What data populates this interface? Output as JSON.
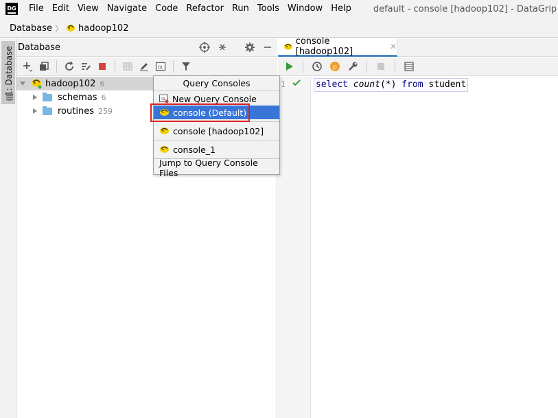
{
  "app": {
    "logo_text": "DG",
    "menu": [
      "File",
      "Edit",
      "View",
      "Navigate",
      "Code",
      "Refactor",
      "Run",
      "Tools",
      "Window",
      "Help"
    ],
    "window_title": "default - console [hadoop102] - DataGrip"
  },
  "breadcrumb": [
    "Database",
    "hadoop102"
  ],
  "tool_strip": {
    "tab_label": "1: Database"
  },
  "database_panel": {
    "title": "Database",
    "tree": [
      {
        "label": "hadoop102",
        "count": "6",
        "expanded": true,
        "level": 0
      },
      {
        "label": "schemas",
        "count": "6",
        "expanded": false,
        "level": 1
      },
      {
        "label": "routines",
        "count": "259",
        "expanded": false,
        "level": 1
      }
    ]
  },
  "popup": {
    "title": "Query Consoles",
    "items": [
      {
        "label": "New Query Console",
        "icon": "new-console-icon",
        "active": false
      },
      {
        "label": "console (Default)",
        "icon": "hadoop-console-icon",
        "active": true
      },
      {
        "label": "console [hadoop102]",
        "icon": "hadoop-console-icon",
        "active": false
      },
      {
        "label": "console_1",
        "icon": "hadoop-console-icon",
        "active": false
      },
      {
        "label": "Jump to Query Console Files",
        "icon": "",
        "active": false
      }
    ]
  },
  "editor": {
    "tab_label": "console [hadoop102]",
    "line_number": "1",
    "code_tokens": [
      {
        "text": "select",
        "kind": "kw"
      },
      {
        "text": " ",
        "kind": "plain"
      },
      {
        "text": "count",
        "kind": "fn"
      },
      {
        "text": "(*) ",
        "kind": "plain"
      },
      {
        "text": "from",
        "kind": "kw"
      },
      {
        "text": " student",
        "kind": "ident"
      }
    ]
  },
  "colors": {
    "selection": "#3875d7",
    "highlight_box": "#e0201e",
    "run_green": "#3a9b3a",
    "stop_red": "#d94040",
    "folder_blue": "#78b7e0",
    "keyword_navy": "#000080"
  }
}
